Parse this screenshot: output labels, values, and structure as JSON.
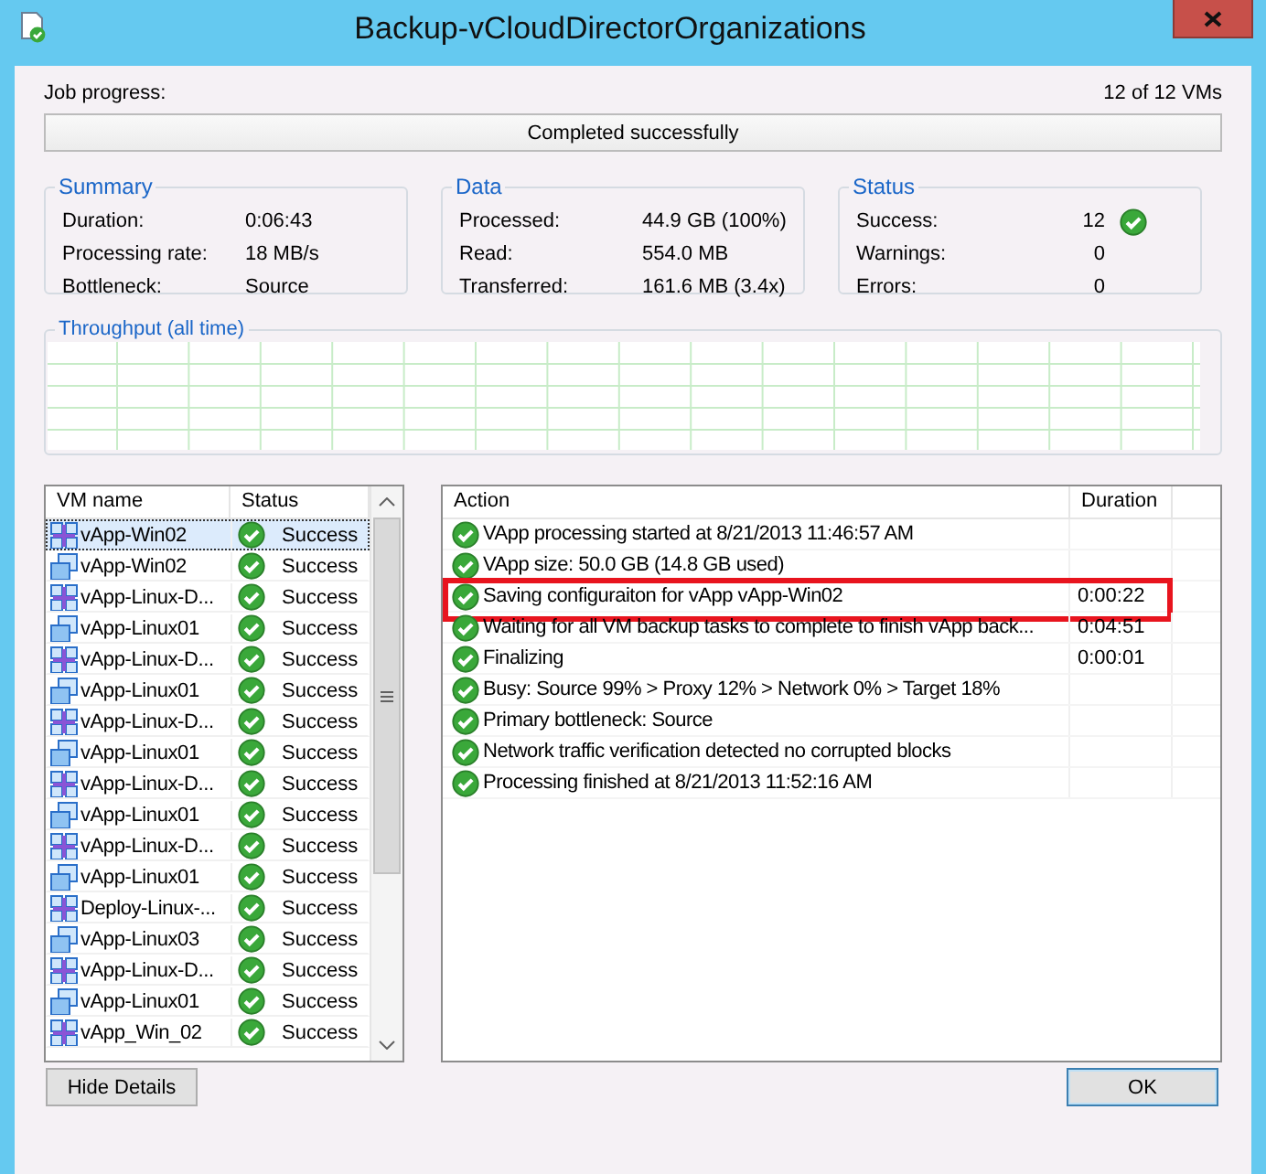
{
  "window": {
    "title": "Backup-vCloudDirectorOrganizations"
  },
  "job_progress": {
    "label": "Job progress:",
    "count": "12 of 12 VMs",
    "status": "Completed successfully",
    "level": 1
  },
  "groups": [
    {
      "title": "Summary",
      "rows": [
        {
          "label": "Duration:",
          "value": "0:06:43",
          "check": false
        },
        {
          "label": "Processing rate:",
          "value": "18 MB/s",
          "check": false
        },
        {
          "label": "Bottleneck:",
          "value": "Source",
          "check": false
        }
      ]
    },
    {
      "title": "Data",
      "rows": [
        {
          "label": "Processed:",
          "value": "44.9 GB (100%)",
          "check": false
        },
        {
          "label": "Read:",
          "value": "554.0 MB",
          "check": false
        },
        {
          "label": "Transferred:",
          "value": "161.6 MB (3.4x)",
          "check": false
        }
      ]
    },
    {
      "title": "Status",
      "rows": [
        {
          "label": "Success:",
          "value": "12",
          "check": true
        },
        {
          "label": "Warnings:",
          "value": "0",
          "check": false
        },
        {
          "label": "Errors:",
          "value": "0",
          "check": false
        }
      ]
    }
  ],
  "throughput": {
    "title": "Throughput (all time)"
  },
  "vm_list": {
    "columns": [
      "VM name",
      "Status"
    ],
    "rows": [
      {
        "name": "vApp-Win02",
        "kind": "vapp",
        "status": "Success",
        "selected": true
      },
      {
        "name": "vApp-Win02",
        "kind": "vm",
        "status": "Success",
        "selected": false
      },
      {
        "name": "vApp-Linux-D...",
        "kind": "vapp",
        "status": "Success",
        "selected": false
      },
      {
        "name": "vApp-Linux01",
        "kind": "vm",
        "status": "Success",
        "selected": false
      },
      {
        "name": "vApp-Linux-D...",
        "kind": "vapp",
        "status": "Success",
        "selected": false
      },
      {
        "name": "vApp-Linux01",
        "kind": "vm",
        "status": "Success",
        "selected": false
      },
      {
        "name": "vApp-Linux-D...",
        "kind": "vapp",
        "status": "Success",
        "selected": false
      },
      {
        "name": "vApp-Linux01",
        "kind": "vm",
        "status": "Success",
        "selected": false
      },
      {
        "name": "vApp-Linux-D...",
        "kind": "vapp",
        "status": "Success",
        "selected": false
      },
      {
        "name": "vApp-Linux01",
        "kind": "vm",
        "status": "Success",
        "selected": false
      },
      {
        "name": "vApp-Linux-D...",
        "kind": "vapp",
        "status": "Success",
        "selected": false
      },
      {
        "name": "vApp-Linux01",
        "kind": "vm",
        "status": "Success",
        "selected": false
      },
      {
        "name": "Deploy-Linux-...",
        "kind": "vapp",
        "status": "Success",
        "selected": false
      },
      {
        "name": "vApp-Linux03",
        "kind": "vm",
        "status": "Success",
        "selected": false
      },
      {
        "name": "vApp-Linux-D...",
        "kind": "vapp",
        "status": "Success",
        "selected": false
      },
      {
        "name": "vApp-Linux01",
        "kind": "vm",
        "status": "Success",
        "selected": false
      },
      {
        "name": "vApp_Win_02",
        "kind": "vapp",
        "status": "Success",
        "selected": false
      }
    ]
  },
  "actions": {
    "columns": [
      "Action",
      "Duration"
    ],
    "rows": [
      {
        "text": "VApp processing started at 8/21/2013 11:46:57 AM",
        "highlighted": false
      },
      {
        "text": "VApp size: 50.0 GB (14.8 GB used)",
        "highlighted": false
      },
      {
        "text": "Saving configuraiton for vApp vApp-Win02",
        "duration": "0:00:22",
        "highlighted": true
      },
      {
        "text": "Waiting for all VM backup tasks to complete to finish vApp back...",
        "duration": "0:04:51",
        "highlighted": false
      },
      {
        "text": "Finalizing",
        "duration": "0:00:01",
        "highlighted": false
      },
      {
        "text": "Busy: Source 99% > Proxy 12% > Network 0% > Target 18%",
        "highlighted": false
      },
      {
        "text": "Primary bottleneck: Source",
        "highlighted": false
      },
      {
        "text": "Network traffic verification detected no corrupted blocks",
        "highlighted": false
      },
      {
        "text": "Processing finished at 8/21/2013 11:52:16 AM",
        "highlighted": false
      }
    ]
  },
  "buttons": [
    {
      "label": "Hide Details",
      "default": false
    },
    {
      "label": "OK",
      "default": true
    }
  ]
}
